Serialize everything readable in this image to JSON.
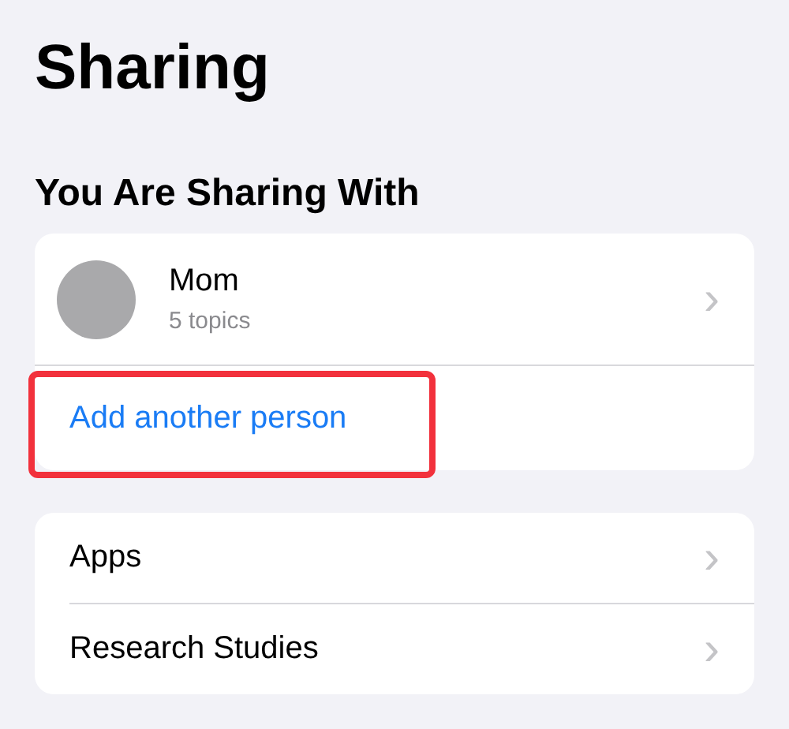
{
  "title": "Sharing",
  "section": {
    "header": "You Are Sharing With",
    "people": [
      {
        "name": "Mom",
        "subtitle": "5 topics",
        "chevron": "›"
      }
    ],
    "add_action": {
      "label": "Add another person",
      "highlighted": true
    }
  },
  "menu": [
    {
      "label": "Apps",
      "chevron": "›"
    },
    {
      "label": "Research Studies",
      "chevron": "›"
    }
  ]
}
